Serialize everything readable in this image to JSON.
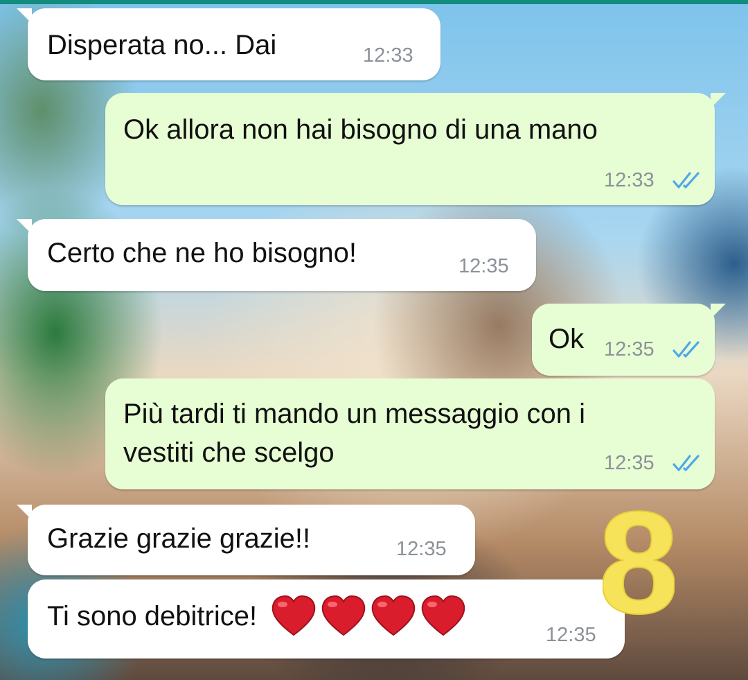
{
  "messages": [
    {
      "direction": "incoming",
      "text": "Disperata no... Dai",
      "time": "12:33"
    },
    {
      "direction": "outgoing",
      "text": "Ok allora non hai bisogno di una mano",
      "time": "12:33",
      "status": "read"
    },
    {
      "direction": "incoming",
      "text": "Certo che ne ho bisogno!",
      "time": "12:35"
    },
    {
      "direction": "outgoing",
      "text": "Ok",
      "time": "12:35",
      "status": "read"
    },
    {
      "direction": "outgoing",
      "text_line1": "Più tardi ti mando un messaggio con i",
      "text_line2": "vestiti che scelgo",
      "time": "12:35",
      "status": "read"
    },
    {
      "direction": "incoming",
      "text": "Grazie grazie grazie!!",
      "time": "12:35"
    },
    {
      "direction": "incoming",
      "text": "Ti sono debitrice!",
      "time": "12:35",
      "emoji": [
        "red-heart",
        "red-heart",
        "red-heart",
        "red-heart"
      ]
    }
  ],
  "sticker": {
    "text": "8",
    "color": "#f7e35a"
  },
  "colors": {
    "incoming_bubble": "#ffffff",
    "outgoing_bubble": "#e7fed4",
    "read_ticks": "#4fa8e8",
    "timestamp": "#8c9199",
    "header_accent": "#128c7e"
  }
}
